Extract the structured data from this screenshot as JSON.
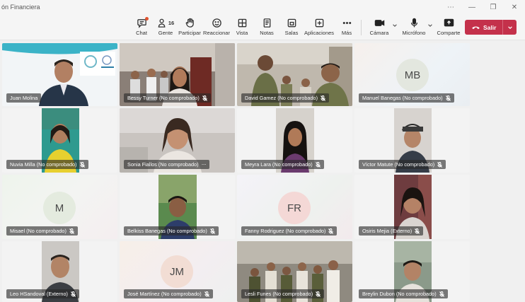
{
  "window": {
    "title": "ón Financiera",
    "controls": [
      "⋯",
      "—",
      "❐",
      "✕"
    ]
  },
  "toolbar": {
    "chat": "Chat",
    "people": "Gente",
    "people_count": "16",
    "raise_hand": "Participar",
    "react": "Reaccionar",
    "view": "Vista",
    "notes": "Notas",
    "rooms": "Salas",
    "apps": "Aplicaciones",
    "more": "Más",
    "camera": "Cámara",
    "mic": "Micrófono",
    "share": "Comparte",
    "leave": "Salir"
  },
  "participants": [
    {
      "name": "Juan Molina",
      "type": "video"
    },
    {
      "name": "Bessy Turner (No comprobado)",
      "type": "video"
    },
    {
      "name": "David Gamez (No comprobado)",
      "type": "video"
    },
    {
      "name": "Manuel Banegas (No comprobado)",
      "type": "avatar",
      "initials": "MB"
    },
    {
      "name": "Nuvia Milla (No comprobado)",
      "type": "video"
    },
    {
      "name": "Sonia Fiallos (No comprobado)",
      "type": "video",
      "more": "···"
    },
    {
      "name": "Meyra Lara (No comprobado)",
      "type": "video"
    },
    {
      "name": "Víctor Matute (No comprobado)",
      "type": "video"
    },
    {
      "name": "Misael (No comprobado)",
      "type": "avatar",
      "initials": "M"
    },
    {
      "name": "Belkiss Banegas (No comprobado)",
      "type": "video"
    },
    {
      "name": "Fanny Rodriguez (No comprobado)",
      "type": "avatar",
      "initials": "FR"
    },
    {
      "name": "Osiris Mejia (Externo)",
      "type": "video"
    },
    {
      "name": "Leo HSandoval (Externo)",
      "type": "video"
    },
    {
      "name": "José Martínez (No comprobado)",
      "type": "avatar",
      "initials": "JM"
    },
    {
      "name": "Lesli Funes (No comprobado)",
      "type": "video"
    },
    {
      "name": "Breylin Dubon (No comprobado)",
      "type": "video"
    }
  ],
  "colors": {
    "leave_button": "#c4314b",
    "notification_dot": "#e0532f",
    "name_tag_bg": "rgba(40,40,40,0.62)"
  }
}
